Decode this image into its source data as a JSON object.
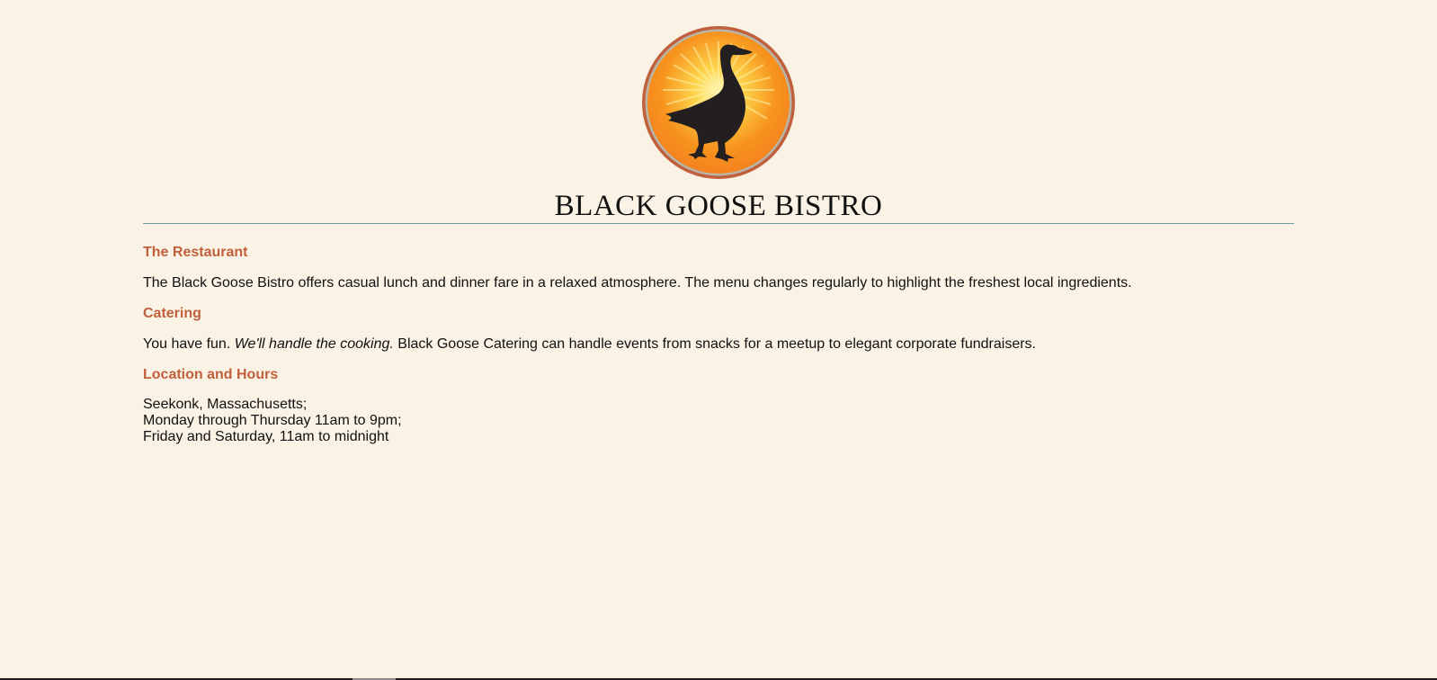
{
  "colors": {
    "background": "#faf2e4",
    "heading": "#c0603c",
    "rule": "#6f9fa3",
    "logo_ring": "#c0603c",
    "logo_sun": "#f7941d"
  },
  "header": {
    "logo_icon": "goose-silhouette-logo-icon",
    "title": "BLACK GOOSE BISTRO"
  },
  "sections": {
    "restaurant": {
      "heading": "The Restaurant",
      "text": "The Black Goose Bistro offers casual lunch and dinner fare in a relaxed atmosphere. The menu changes regularly to highlight the freshest local ingredients."
    },
    "catering": {
      "heading": "Catering",
      "lead": "You have fun.",
      "emphasis": "We'll handle the cooking.",
      "rest": "Black Goose Catering can handle events from snacks for a meetup to elegant corporate fundraisers."
    },
    "location": {
      "heading": "Location and Hours",
      "lines": [
        "Seekonk, Massachusetts;",
        "Monday through Thursday 11am to 9pm;",
        "Friday and Saturday, 11am to midnight"
      ]
    }
  }
}
